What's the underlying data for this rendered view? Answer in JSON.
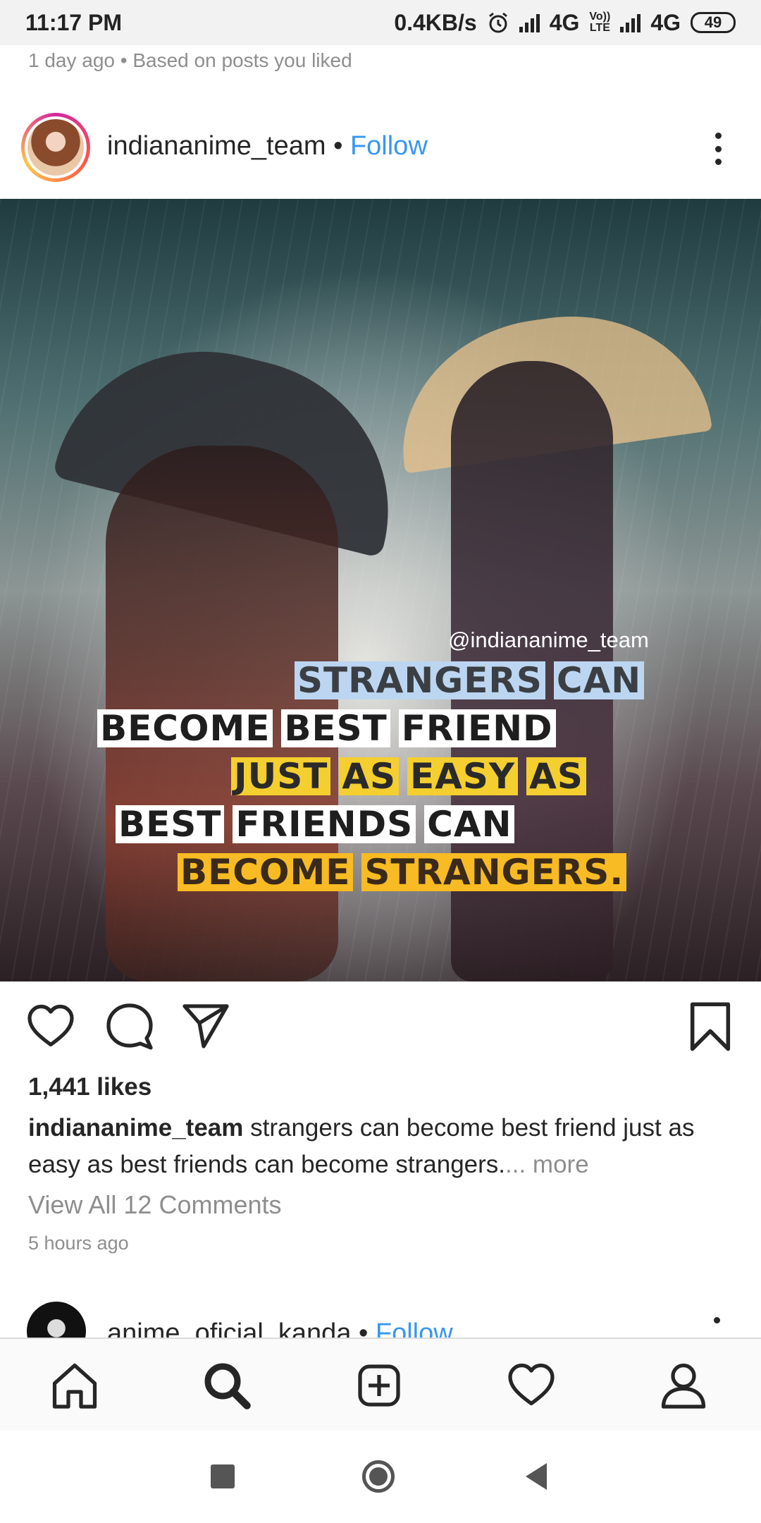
{
  "status_bar": {
    "time": "11:17 PM",
    "speed": "0.4KB/s",
    "network1": "4G",
    "volte_top": "Vo))",
    "volte_bottom": "LTE",
    "network2": "4G",
    "battery": "49"
  },
  "feed_note": "1 day ago • Based on posts you liked",
  "post": {
    "username": "indiananime_team",
    "separator": " • ",
    "follow_label": "Follow",
    "image": {
      "watermark": "@indiananime_team",
      "quote_lines": [
        [
          "STRANGERS",
          "CAN"
        ],
        [
          "BECOME",
          "BEST",
          "FRIEND"
        ],
        [
          "JUST",
          "AS",
          "EASY",
          "AS"
        ],
        [
          "BEST",
          "FRIENDS",
          "CAN"
        ],
        [
          "BECOME",
          "STRANGERS."
        ]
      ]
    },
    "likes": "1,441 likes",
    "caption_user": "indiananime_team",
    "caption_text": " strangers can become best friend just as easy as best friends can become strangers.",
    "caption_more": "... more",
    "view_comments": "View All 12 Comments",
    "time_ago": "5 hours ago"
  },
  "next_post": {
    "username": "anime_oficial_kanda",
    "separator": " • ",
    "follow_label": "Follow"
  },
  "icons": {
    "like": "heart-icon",
    "comment": "comment-icon",
    "share": "send-icon",
    "save": "bookmark-icon",
    "more": "more-vertical-icon",
    "nav_home": "home-icon",
    "nav_search": "search-icon",
    "nav_add": "add-post-icon",
    "nav_activity": "activity-heart-icon",
    "nav_profile": "profile-icon"
  },
  "colors": {
    "accent": "#3897f0",
    "muted": "#8e8e8e",
    "text": "#262626"
  }
}
